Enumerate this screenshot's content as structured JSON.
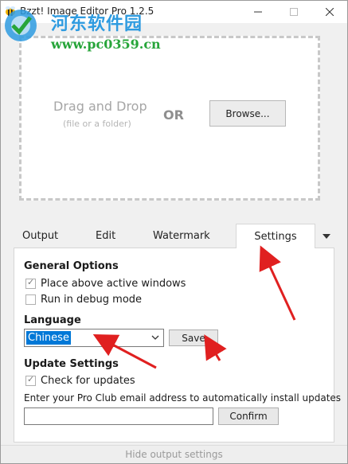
{
  "window": {
    "title": "Bzzt! Image Editor Pro 1.2.5",
    "min_icon": "minimize-icon",
    "max_icon": "maximize-icon",
    "close_icon": "close-icon"
  },
  "watermark": {
    "site_name": "河东软件园",
    "url": "www.pc0359.cn"
  },
  "dropzone": {
    "title": "Drag and Drop",
    "subtitle": "(file or a folder)",
    "or_label": "OR",
    "browse_label": "Browse..."
  },
  "tabs": [
    {
      "label": "Output"
    },
    {
      "label": "Edit"
    },
    {
      "label": "Watermark"
    },
    {
      "label": "Settings",
      "active": true
    }
  ],
  "settings": {
    "general_title": "General Options",
    "place_above_label": "Place above active windows",
    "place_above_checked": true,
    "debug_label": "Run in debug mode",
    "debug_checked": false,
    "language_title": "Language",
    "language_value": "Chinese",
    "save_label": "Save",
    "update_title": "Update Settings",
    "check_updates_label": "Check for updates",
    "check_updates_checked": true,
    "email_hint": "Enter your Pro Club email address to automatically install updates",
    "email_value": "",
    "confirm_label": "Confirm"
  },
  "footer": {
    "label": "Hide output settings"
  },
  "colors": {
    "accent": "#0078d7",
    "annotation_arrow": "#e02020",
    "watermark_blue": "#2e9be0",
    "watermark_green": "#27a53a"
  }
}
